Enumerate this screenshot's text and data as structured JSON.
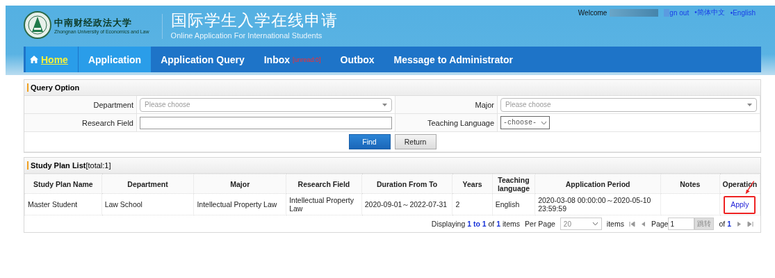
{
  "header": {
    "university_name": "中南财经政法大学",
    "university_name_en": "Zhongnan University of Economics and Law",
    "title": "国际学生入学在线申请",
    "subtitle": "Online Application For International Students",
    "welcome": "Welcome",
    "sign_out": "gn out",
    "languages": [
      "•简体中文",
      "•English"
    ]
  },
  "nav": [
    {
      "label": "Home",
      "selected": true,
      "highlighted": true
    },
    {
      "label": "Application",
      "selected": false,
      "highlighted": true
    },
    {
      "label": "Application Query",
      "selected": false,
      "highlighted": false
    },
    {
      "label": "Inbox",
      "selected": false,
      "highlighted": false,
      "badge": "[unread:0]"
    },
    {
      "label": "Outbox",
      "selected": false,
      "highlighted": false
    },
    {
      "label": "Message to Administrator",
      "selected": false,
      "highlighted": false
    }
  ],
  "query": {
    "title": "Query Option",
    "fields": [
      {
        "label": "Department",
        "kind": "combo",
        "placeholder": "Please choose"
      },
      {
        "label": "Major",
        "kind": "combo",
        "placeholder": "Please choose"
      },
      {
        "label": "Research Field",
        "kind": "text"
      },
      {
        "label": "Teaching Language",
        "kind": "select",
        "value": "-choose-"
      }
    ],
    "buttons": [
      {
        "label": "Find",
        "kind": "primary"
      },
      {
        "label": "Return",
        "kind": "secondary"
      }
    ]
  },
  "study_plans": {
    "title": "**Study Plan List**[total:1]",
    "columns": [
      "Study Plan Name",
      "Department",
      "Major",
      "Research Field",
      "Duration From To",
      "Years",
      "Teaching language",
      "Application Period",
      "Notes",
      "Operation"
    ],
    "rows": [
      {
        "cells": [
          "Master Student",
          "Law School",
          "Intellectual Property Law",
          "Intellectual Property Law",
          "2020-09-01～2022-07-31",
          "2",
          "English",
          "2020-03-08 00:00:00～2020-05-10 23:59:59",
          ""
        ],
        "action": "Apply",
        "highlighted": true
      }
    ],
    "pager": {
      "summary": "Displaying **1 to 1** of **1** items",
      "per_page_label": "Per Page",
      "per_page": "20",
      "items_label": "items",
      "page_label": "Page",
      "page": "1",
      "go": "跳转",
      "of": "of **1**"
    }
  }
}
